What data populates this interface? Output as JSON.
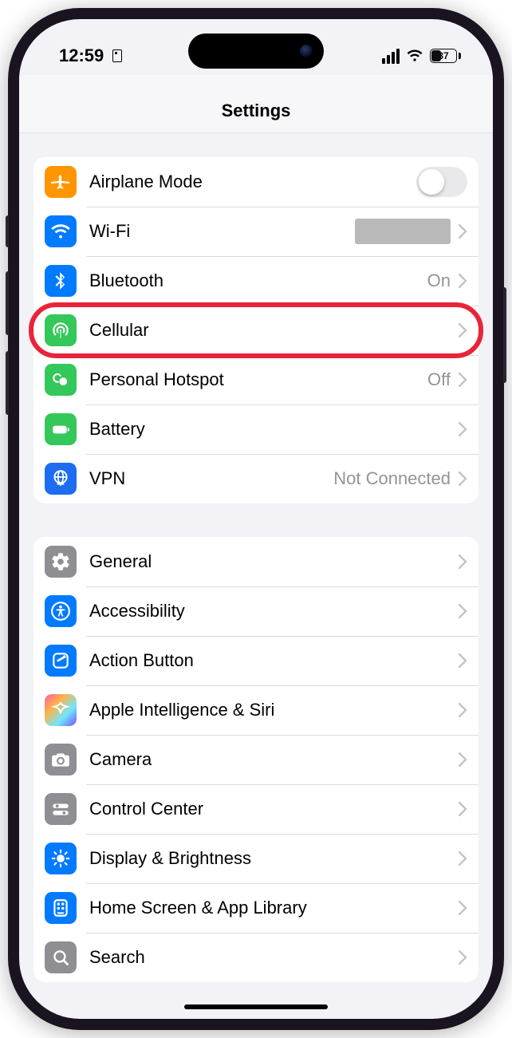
{
  "status": {
    "time": "12:59",
    "battery_pct": "37"
  },
  "header": {
    "title": "Settings"
  },
  "group1": [
    {
      "id": "airplane",
      "label": "Airplane Mode",
      "icon": "airplane-icon",
      "color": "c-orange",
      "type": "toggle",
      "on": false
    },
    {
      "id": "wifi",
      "label": "Wi-Fi",
      "icon": "wifi-icon",
      "color": "c-blue",
      "type": "navRedacted"
    },
    {
      "id": "bluetooth",
      "label": "Bluetooth",
      "icon": "bluetooth-icon",
      "color": "c-blue",
      "type": "nav",
      "value": "On"
    },
    {
      "id": "cellular",
      "label": "Cellular",
      "icon": "cellular-icon",
      "color": "c-green",
      "type": "nav",
      "highlight": true
    },
    {
      "id": "hotspot",
      "label": "Personal Hotspot",
      "icon": "hotspot-icon",
      "color": "c-green",
      "type": "nav",
      "value": "Off"
    },
    {
      "id": "battery",
      "label": "Battery",
      "icon": "battery-icon",
      "color": "c-green",
      "type": "nav"
    },
    {
      "id": "vpn",
      "label": "VPN",
      "icon": "vpn-icon",
      "color": "c-bluedeep",
      "type": "nav",
      "value": "Not Connected"
    }
  ],
  "group2": [
    {
      "id": "general",
      "label": "General",
      "icon": "gear-icon",
      "color": "c-gray",
      "type": "nav"
    },
    {
      "id": "accessibility",
      "label": "Accessibility",
      "icon": "accessibility-icon",
      "color": "c-blue",
      "type": "nav"
    },
    {
      "id": "actionbutton",
      "label": "Action Button",
      "icon": "action-button-icon",
      "color": "c-blue",
      "type": "nav"
    },
    {
      "id": "appleintel",
      "label": "Apple Intelligence & Siri",
      "icon": "apple-intelligence-icon",
      "color": "c-multi",
      "type": "nav"
    },
    {
      "id": "camera",
      "label": "Camera",
      "icon": "camera-icon",
      "color": "c-gray",
      "type": "nav"
    },
    {
      "id": "controlcenter",
      "label": "Control Center",
      "icon": "control-center-icon",
      "color": "c-gray",
      "type": "nav"
    },
    {
      "id": "display",
      "label": "Display & Brightness",
      "icon": "display-brightness-icon",
      "color": "c-blue",
      "type": "nav"
    },
    {
      "id": "homescreen",
      "label": "Home Screen & App Library",
      "icon": "home-screen-icon",
      "color": "c-blue",
      "type": "nav"
    },
    {
      "id": "search",
      "label": "Search",
      "icon": "search-icon",
      "color": "c-gray",
      "type": "nav"
    }
  ]
}
